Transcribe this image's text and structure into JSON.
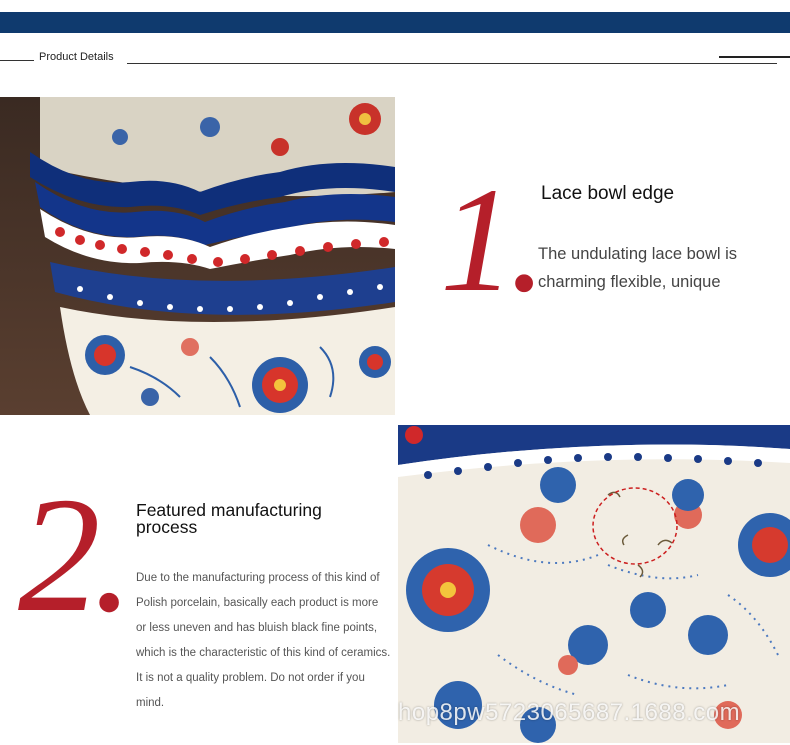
{
  "header": {
    "label": "Product Details"
  },
  "feature1": {
    "number": "1.",
    "title": "Lace bowl edge",
    "description": "The undulating lace bowl is charming flexible, unique"
  },
  "feature2": {
    "number": "2.",
    "title": "Featured manufacturing process",
    "description": "Due to the manufacturing process of this kind of Polish porcelain, basically each product is more or less uneven and has bluish black fine points, which is the characteristic of this kind of ceramics. It is not a quality problem. Do not order if you mind."
  },
  "watermark": "hop8pw5723065687.1688.com",
  "colors": {
    "topbar": "#0f3a6e",
    "numeral": "#b51f2a"
  }
}
